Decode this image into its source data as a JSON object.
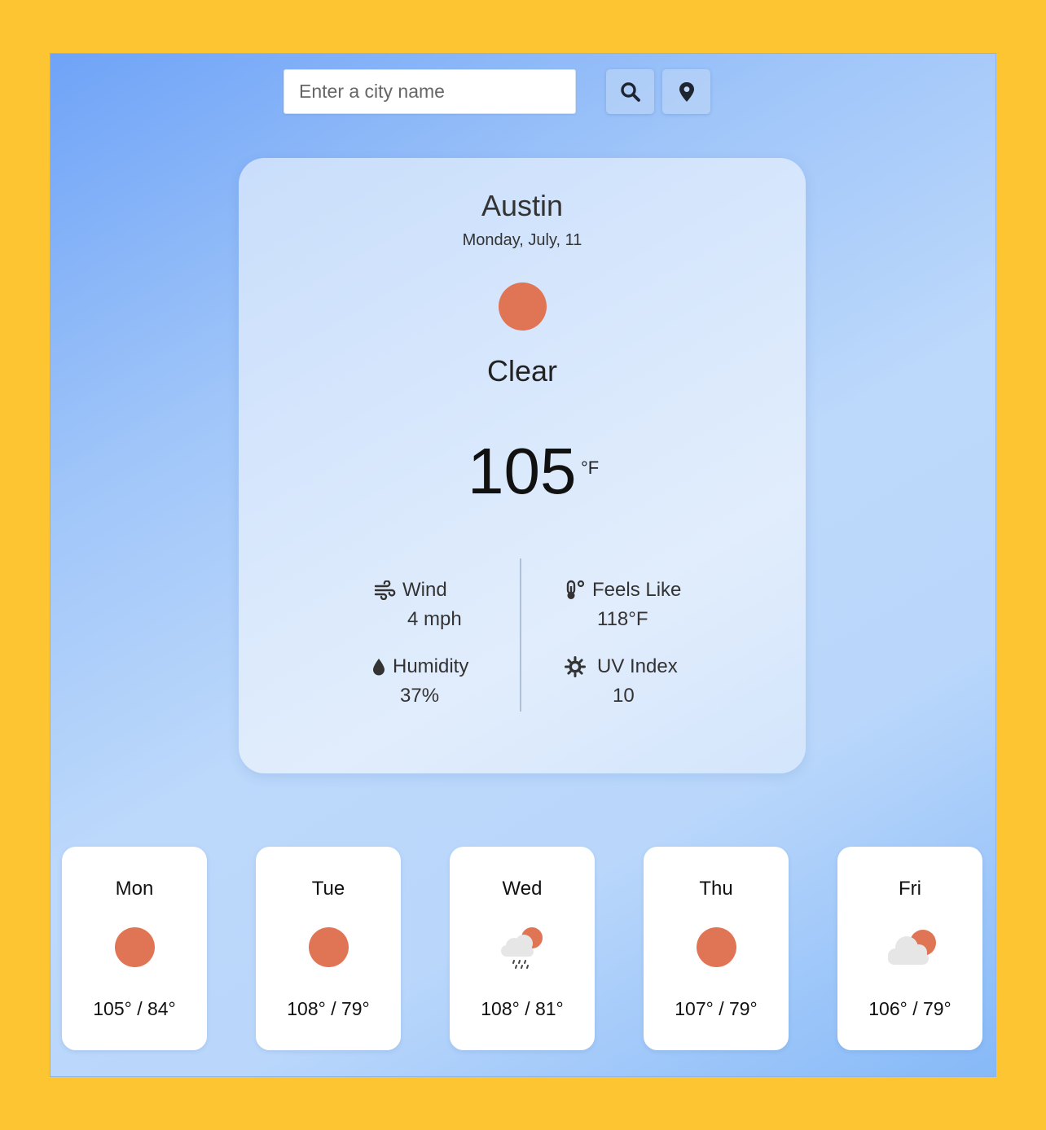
{
  "search": {
    "placeholder": "Enter a city name"
  },
  "buttons": {
    "search_icon": "search-icon",
    "location_icon": "map-pin-icon"
  },
  "current": {
    "city": "Austin",
    "date": "Monday, July, 11",
    "icon": "sun-icon",
    "condition": "Clear",
    "temperature": "105",
    "unit": "°F",
    "stats": {
      "wind": {
        "label": "Wind",
        "value": "4 mph",
        "icon": "wind-icon"
      },
      "feels_like": {
        "label": "Feels Like",
        "value": "118°F",
        "icon": "thermometer-icon"
      },
      "humidity": {
        "label": "Humidity",
        "value": "37%",
        "icon": "droplet-icon"
      },
      "uv_index": {
        "label": "UV Index",
        "value": "10",
        "icon": "sun-gear-icon"
      }
    }
  },
  "forecast": [
    {
      "day": "Mon",
      "icon": "sun-icon",
      "temps": "105° / 84°"
    },
    {
      "day": "Tue",
      "icon": "sun-icon",
      "temps": "108° / 79°"
    },
    {
      "day": "Wed",
      "icon": "rain-cloud-sun-icon",
      "temps": "108° / 81°"
    },
    {
      "day": "Thu",
      "icon": "sun-icon",
      "temps": "107° / 79°"
    },
    {
      "day": "Fri",
      "icon": "partly-cloudy-icon",
      "temps": "106° / 79°"
    }
  ],
  "colors": {
    "background": "#fec532",
    "sun": "#e07555",
    "card": "#d9e8fc"
  }
}
